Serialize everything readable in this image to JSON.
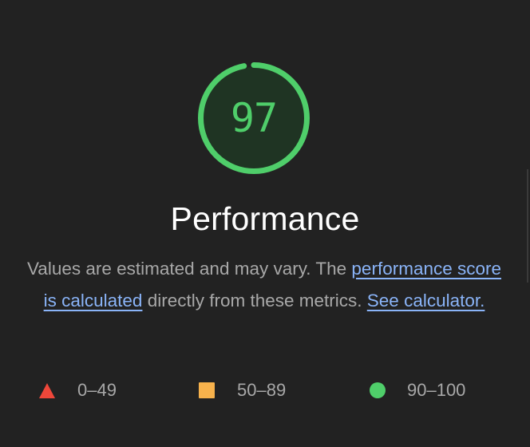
{
  "category": {
    "score": "97",
    "score_fraction": 0.97,
    "title": "Performance",
    "colors": {
      "pass": "#4fce6a",
      "average": "#f7b24c",
      "fail": "#ef473a",
      "gauge_track": "#1f3423",
      "link": "#8ab4f8"
    }
  },
  "description": {
    "text_before": "Values are estimated and may vary. The ",
    "link1": "performance score is calculated",
    "text_middle": " directly from these metrics. ",
    "link2": "See calculator."
  },
  "legend": {
    "fail": {
      "icon": "triangle-icon",
      "label": "0–49"
    },
    "average": {
      "icon": "square-icon",
      "label": "50–89"
    },
    "pass": {
      "icon": "circle-icon",
      "label": "90–100"
    }
  }
}
